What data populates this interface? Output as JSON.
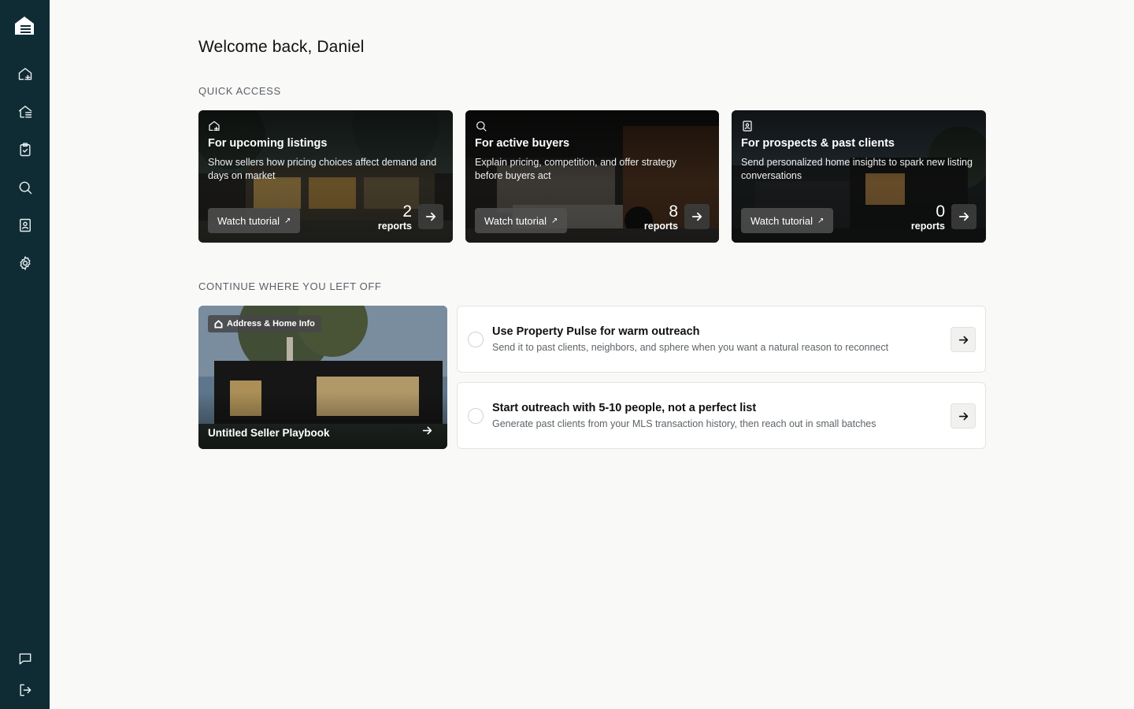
{
  "sidebar": {
    "logo": "house-logo-icon",
    "items": [
      {
        "icon": "home-add-icon"
      },
      {
        "icon": "home-list-icon"
      },
      {
        "icon": "clipboard-check-icon"
      },
      {
        "icon": "search-icon"
      },
      {
        "icon": "contact-book-icon"
      },
      {
        "icon": "gear-icon"
      }
    ],
    "bottom": [
      {
        "icon": "chat-icon"
      },
      {
        "icon": "logout-icon"
      }
    ]
  },
  "welcome": "Welcome back, Daniel",
  "quick_access": {
    "title": "QUICK ACCESS",
    "cards": [
      {
        "icon": "home-add-icon",
        "title": "For upcoming listings",
        "description": "Show sellers how pricing choices affect demand and days on market",
        "tutorial_label": "Watch tutorial",
        "count": "2",
        "count_label": "reports"
      },
      {
        "icon": "search-icon",
        "title": "For active buyers",
        "description": "Explain pricing, competition, and offer strategy before buyers act",
        "tutorial_label": "Watch tutorial",
        "count": "8",
        "count_label": "reports"
      },
      {
        "icon": "contact-book-icon",
        "title": "For prospects & past clients",
        "description": "Send personalized home insights to spark new listing conversations",
        "tutorial_label": "Watch tutorial",
        "count": "0",
        "count_label": "reports"
      }
    ]
  },
  "continue": {
    "title": "CONTINUE WHERE YOU LEFT OFF",
    "playbook": {
      "badge": "Address & Home Info",
      "title": "Untitled Seller Playbook"
    },
    "tasks": [
      {
        "title": "Use Property Pulse for warm outreach",
        "description": "Send it to past clients, neighbors, and sphere when you want a natural reason to reconnect"
      },
      {
        "title": "Start outreach with 5-10 people, not a perfect list",
        "description": "Generate past clients from your MLS transaction history, then reach out in small batches"
      }
    ]
  },
  "colors": {
    "sidebar": "#0f2c35",
    "background": "#f9f9f8",
    "card_border": "#e4e4e2"
  }
}
